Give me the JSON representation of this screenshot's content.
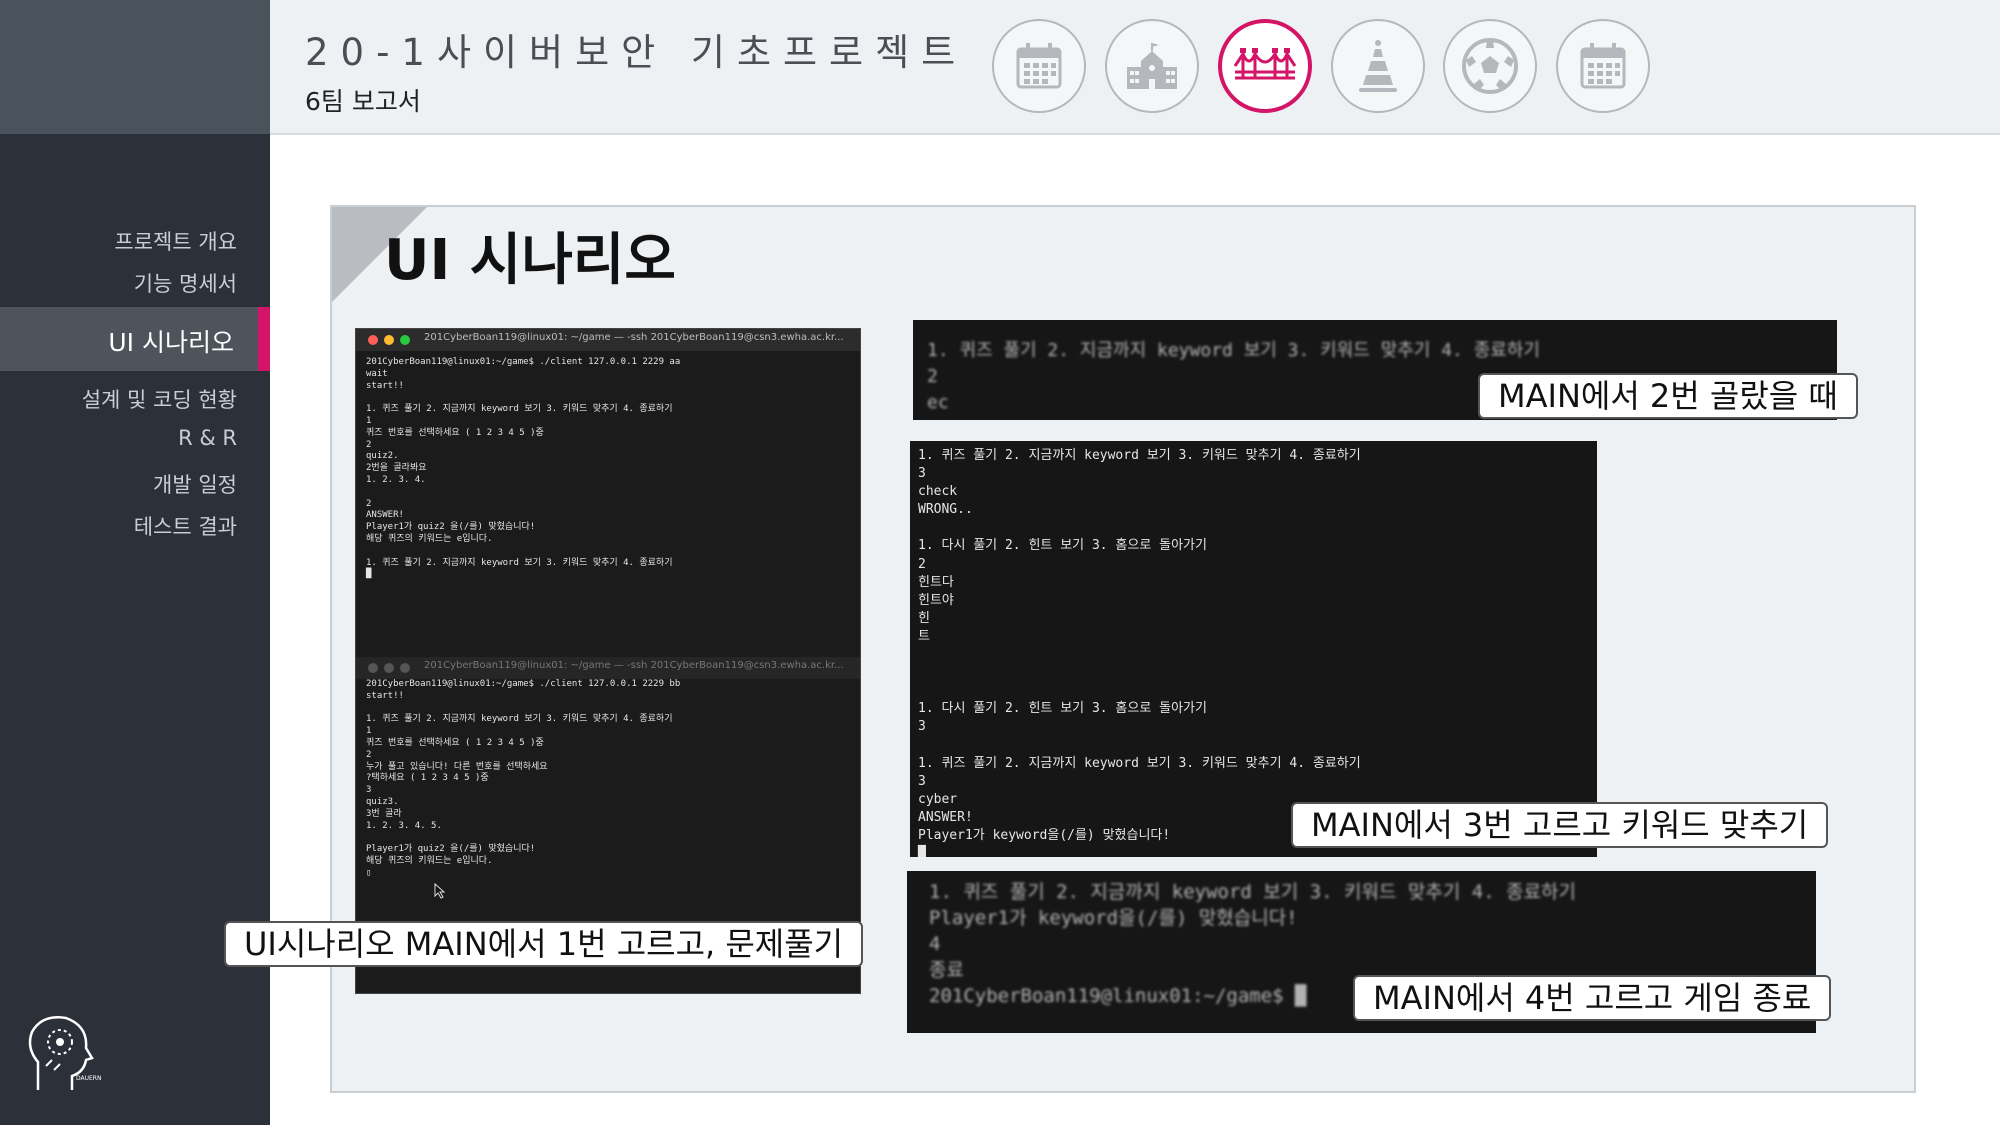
{
  "header": {
    "title": "20-1사이버보안 기초프로젝트",
    "subtitle": "6팀 보고서",
    "icons": [
      "calendar-icon",
      "school-icon",
      "bridge-icon",
      "party-hat-icon",
      "soccer-ball-icon",
      "calendar-icon"
    ],
    "active_icon_index": 2,
    "accent_color": "#d31467"
  },
  "sidebar": {
    "items": [
      {
        "label": "프로젝트 개요"
      },
      {
        "label": "기능 명세서"
      },
      {
        "label": "UI 시나리오",
        "active": true
      },
      {
        "label": "설계 및 코딩 현황"
      },
      {
        "label": "R & R"
      },
      {
        "label": "개발 일정"
      },
      {
        "label": "테스트 결과"
      }
    ],
    "logo_text": "DAUERN"
  },
  "slide": {
    "title": "UI 시나리오"
  },
  "terminals": {
    "t1": {
      "window_title": "201CyberBoan119@linux01: ~/game — -ssh 201CyberBoan119@csn3.ewha.ac.kr...",
      "lines": [
        "201CyberBoan119@linux01:~/game$ ./client 127.0.0.1 2229 aa",
        "wait",
        "start!!",
        "",
        "1. 퀴즈 풀기 2. 지금까지 keyword 보기 3. 키워드 맞추기 4. 종료하기",
        "1",
        "퀴즈 번호를 선택하세요 ( 1 2 3 4 5 )중",
        "2",
        "quiz2.",
        "2번을 골라봐요",
        "1. 2. 3. 4.",
        "",
        "2",
        "ANSWER!",
        "Player1가 quiz2 을(/를) 맞혔습니다!",
        "해당 퀴즈의 키워드는 e입니다.",
        "",
        "1. 퀴즈 풀기 2. 지금까지 keyword 보기 3. 키워드 맞추기 4. 종료하기",
        "█"
      ]
    },
    "t2": {
      "window_title": "201CyberBoan119@linux01: ~/game — -ssh 201CyberBoan119@csn3.ewha.ac.kr...",
      "lines": [
        "201CyberBoan119@linux01:~/game$ ./client 127.0.0.1 2229 bb",
        "start!!",
        "",
        "1. 퀴즈 풀기 2. 지금까지 keyword 보기 3. 키워드 맞추기 4. 종료하기",
        "1",
        "퀴즈 번호를 선택하세요 ( 1 2 3 4 5 )중",
        "2",
        "누가 풀고 있습니다! 다른 번호를 선택하세요",
        "?택하세요 ( 1 2 3 4 5 )중",
        "3",
        "quiz3.",
        "3번 골라",
        "1. 2. 3. 4. 5.",
        "",
        "Player1가 quiz2 을(/를) 맞혔습니다!",
        "해당 퀴즈의 키워드는 e입니다.",
        "▯"
      ]
    },
    "t3": {
      "lines": [
        "1. 퀴즈 풀기 2. 지금까지 keyword 보기 3. 키워드 맞추기 4. 종료하기",
        "2",
        "ec"
      ]
    },
    "t4": {
      "lines": [
        "1. 퀴즈 풀기 2. 지금까지 keyword 보기 3. 키워드 맞추기 4. 종료하기",
        "3",
        "check",
        "WRONG..",
        "",
        "1. 다시 풀기 2. 힌트 보기 3. 홈으로 돌아가기",
        "2",
        "힌트다",
        "힌트야",
        "힌",
        "트",
        "",
        "",
        "",
        "1. 다시 풀기 2. 힌트 보기 3. 홈으로 돌아가기",
        "3",
        "",
        "1. 퀴즈 풀기 2. 지금까지 keyword 보기 3. 키워드 맞추기 4. 종료하기",
        "3",
        "cyber",
        "ANSWER!",
        "Player1가 keyword을(/를) 맞혔습니다!",
        "█"
      ]
    },
    "t5": {
      "lines": [
        "1. 퀴즈 풀기 2. 지금까지 keyword 보기 3. 키워드 맞추기 4. 종료하기",
        "Player1가 keyword을(/를) 맞혔습니다!",
        "4",
        "종료",
        "201CyberBoan119@linux01:~/game$ █"
      ]
    }
  },
  "captions": {
    "c1": "UI시나리오 MAIN에서 1번 고르고, 문제풀기",
    "c2": "MAIN에서 2번 골랐을 때",
    "c3": "MAIN에서 3번 고르고 키워드 맞추기",
    "c4": "MAIN에서 4번 고르고 게임 종료"
  }
}
